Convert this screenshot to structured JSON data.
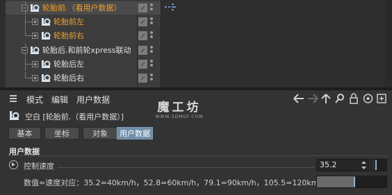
{
  "object_tree": {
    "rows": [
      {
        "name": "轮胎前.（看用户数据）",
        "color": "#f0a030",
        "expander": "minus"
      },
      {
        "name": "轮胎前左",
        "color": "#f0a030",
        "expander": "plus"
      },
      {
        "name": "轮胎前右",
        "color": "#f0a030",
        "expander": "plus"
      },
      {
        "name": "轮胎后.和前轮xpress联动",
        "color": "#e2e2e2",
        "expander": "minus"
      },
      {
        "name": "轮胎后左",
        "color": "#e2e2e2",
        "expander": "plus"
      },
      {
        "name": "轮胎后右",
        "color": "#e2e2e2",
        "expander": "plus"
      }
    ],
    "tag_icon": "xpresso-tag-icon"
  },
  "menubar": {
    "items": [
      "模式",
      "编辑",
      "用户数据"
    ],
    "nav_icons": [
      "arrow-left-icon",
      "arrow-right-icon",
      "arrow-up-icon",
      "search-icon",
      "lock-icon",
      "target-icon",
      "new-window-icon"
    ]
  },
  "watermark": {
    "title": "魔工坊",
    "url": "WWW.3DMGF.COM"
  },
  "object": {
    "title": "空白 [轮胎前.（看用户数据）]"
  },
  "tabs": [
    {
      "label": "基本",
      "active": false
    },
    {
      "label": "坐标",
      "active": false
    },
    {
      "label": "对象",
      "active": false
    },
    {
      "label": "用户数据",
      "active": true
    }
  ],
  "section": {
    "title": "用户数据"
  },
  "params": {
    "speed": {
      "label": "控制速度",
      "value": "35.2",
      "slider_fraction": 0.35
    },
    "info": {
      "label": "数值≈速度对应：35.2=40km/h，52.8=60km/h，79.1=90km/h，105.5=120km/h",
      "slider_fraction": 0.55
    }
  },
  "colors": {
    "accent_tab": "#6f8ea8",
    "orange_text": "#f0a030",
    "background": "#333333"
  }
}
